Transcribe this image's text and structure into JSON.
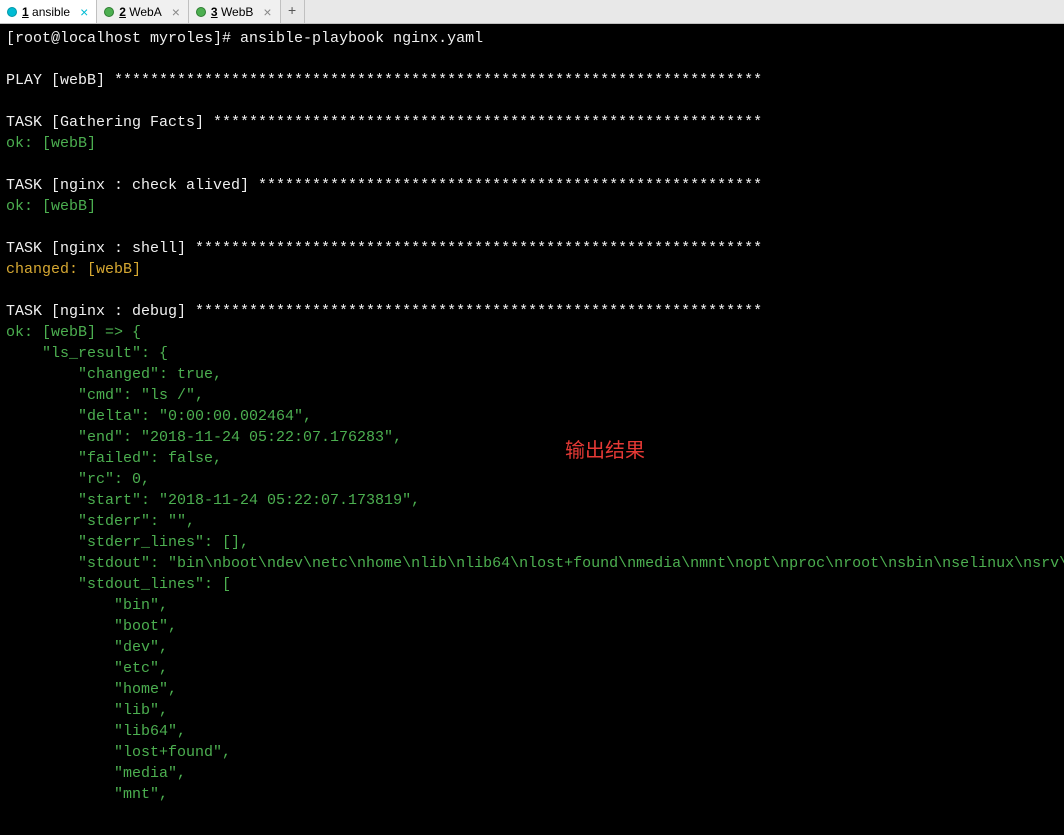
{
  "tabs": [
    {
      "num": "1",
      "label": "ansible",
      "active": true,
      "dot": "active-conn"
    },
    {
      "num": "2",
      "label": "WebA",
      "active": false,
      "dot": "connected"
    },
    {
      "num": "3",
      "label": "WebB",
      "active": false,
      "dot": "connected"
    }
  ],
  "overlay": "输出结果",
  "prompt": "[root@localhost myroles]# ",
  "command": "ansible-playbook nginx.yaml",
  "lines": [
    {
      "cls": "white",
      "t": ""
    },
    {
      "cls": "white",
      "t": "PLAY [webB] ************************************************************************"
    },
    {
      "cls": "white",
      "t": ""
    },
    {
      "cls": "white",
      "t": "TASK [Gathering Facts] *************************************************************"
    },
    {
      "cls": "green",
      "t": "ok: [webB]"
    },
    {
      "cls": "white",
      "t": ""
    },
    {
      "cls": "white",
      "t": "TASK [nginx : check alived] ********************************************************"
    },
    {
      "cls": "green",
      "t": "ok: [webB]"
    },
    {
      "cls": "white",
      "t": ""
    },
    {
      "cls": "white",
      "t": "TASK [nginx : shell] ***************************************************************"
    },
    {
      "cls": "yellow",
      "t": "changed: [webB]"
    },
    {
      "cls": "white",
      "t": ""
    },
    {
      "cls": "white",
      "t": "TASK [nginx : debug] ***************************************************************"
    },
    {
      "cls": "green",
      "t": "ok: [webB] => {"
    },
    {
      "cls": "green",
      "t": "    \"ls_result\": {"
    },
    {
      "cls": "green",
      "t": "        \"changed\": true,"
    },
    {
      "cls": "green",
      "t": "        \"cmd\": \"ls /\","
    },
    {
      "cls": "green",
      "t": "        \"delta\": \"0:00:00.002464\","
    },
    {
      "cls": "green",
      "t": "        \"end\": \"2018-11-24 05:22:07.176283\","
    },
    {
      "cls": "green",
      "t": "        \"failed\": false,"
    },
    {
      "cls": "green",
      "t": "        \"rc\": 0,"
    },
    {
      "cls": "green",
      "t": "        \"start\": \"2018-11-24 05:22:07.173819\","
    },
    {
      "cls": "green",
      "t": "        \"stderr\": \"\","
    },
    {
      "cls": "green",
      "t": "        \"stderr_lines\": [],"
    },
    {
      "cls": "green",
      "t": "        \"stdout\": \"bin\\nboot\\ndev\\netc\\nhome\\nlib\\nlib64\\nlost+found\\nmedia\\nmnt\\nopt\\nproc\\nroot\\nsbin\\nselinux\\nsrv\\nsys\\ntmp\\nusr\\nvar\","
    },
    {
      "cls": "green",
      "t": "        \"stdout_lines\": ["
    },
    {
      "cls": "green",
      "t": "            \"bin\","
    },
    {
      "cls": "green",
      "t": "            \"boot\","
    },
    {
      "cls": "green",
      "t": "            \"dev\","
    },
    {
      "cls": "green",
      "t": "            \"etc\","
    },
    {
      "cls": "green",
      "t": "            \"home\","
    },
    {
      "cls": "green",
      "t": "            \"lib\","
    },
    {
      "cls": "green",
      "t": "            \"lib64\","
    },
    {
      "cls": "green",
      "t": "            \"lost+found\","
    },
    {
      "cls": "green",
      "t": "            \"media\","
    },
    {
      "cls": "green",
      "t": "            \"mnt\","
    }
  ]
}
